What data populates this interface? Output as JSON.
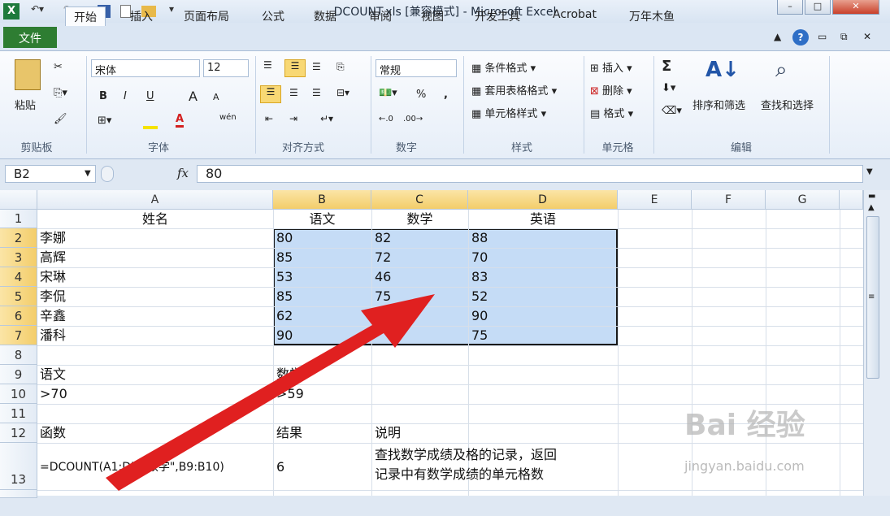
{
  "window": {
    "title": "DCOUNT.xls  [兼容模式]  -  Microsoft Excel",
    "min_label": "–",
    "max_label": "□",
    "close_label": "✕"
  },
  "tabs": {
    "file": "文件",
    "items": [
      "开始",
      "插入",
      "页面布局",
      "公式",
      "数据",
      "审阅",
      "视图",
      "开发工具",
      "Acrobat",
      "万年木鱼"
    ],
    "active_index": 0
  },
  "ribbon": {
    "clipboard": {
      "paste": "粘贴",
      "label": "剪贴板"
    },
    "font": {
      "name": "宋体",
      "size": "12",
      "bold": "B",
      "italic": "I",
      "underline": "U",
      "grow": "A",
      "shrink": "A",
      "label": "字体",
      "wen": "wén"
    },
    "align": {
      "label": "对齐方式"
    },
    "number": {
      "format": "常规",
      "percent": "%",
      "comma": ",",
      "label": "数字"
    },
    "styles": {
      "cond": "条件格式",
      "table": "套用表格格式",
      "cell": "单元格样式",
      "label": "样式"
    },
    "cells": {
      "insert": "插入",
      "delete": "删除",
      "format": "格式",
      "label": "单元格"
    },
    "edit": {
      "sigma": "Σ",
      "sort": "排序和筛选",
      "find": "查找和选择",
      "label": "编辑"
    }
  },
  "formula_bar": {
    "name_box": "B2",
    "fx": "fx",
    "value": "80"
  },
  "columns": [
    "A",
    "B",
    "C",
    "D",
    "E",
    "F",
    "G"
  ],
  "rows": [
    "1",
    "2",
    "3",
    "4",
    "5",
    "6",
    "7",
    "8",
    "9",
    "10",
    "11",
    "12",
    "13"
  ],
  "cells": {
    "header": {
      "a": "姓名",
      "b": "语文",
      "c": "数学",
      "d": "英语"
    },
    "data": [
      {
        "name": "李娜",
        "b": "80",
        "c": "82",
        "d": "88"
      },
      {
        "name": "高辉",
        "b": "85",
        "c": "72",
        "d": "70"
      },
      {
        "name": "宋琳",
        "b": "53",
        "c": "46",
        "d": "83"
      },
      {
        "name": "李侃",
        "b": "85",
        "c": "75",
        "d": "52"
      },
      {
        "name": "辛鑫",
        "b": "62",
        "c": "",
        "d": "90"
      },
      {
        "name": "潘科",
        "b": "90",
        "c": "",
        "d": "75"
      }
    ],
    "r9": {
      "a": "语文",
      "b": "数学"
    },
    "r10": {
      "a": ">70",
      "b": ">59"
    },
    "r12": {
      "a": "函数",
      "b": "结果",
      "c": "说明"
    },
    "r13": {
      "a": "=DCOUNT(A1:D7,\"数学\",B9:B10)",
      "b": "6",
      "c1": "查找数学成绩及格的记录，返回",
      "c2": "记录中有数学成绩的单元格数"
    }
  },
  "watermark": {
    "main": "Bai 经验",
    "sub": "jingyan.baidu.com"
  },
  "colors": {
    "selection": "#c5dcf6",
    "header_highlight": "#f3cd6a",
    "arrow": "#e02020",
    "file_tab": "#2e7d32"
  }
}
